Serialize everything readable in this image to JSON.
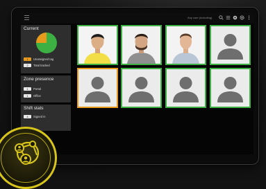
{
  "topbar": {
    "filter_label": "Any user (including)",
    "icons": [
      "search-icon",
      "list-icon",
      "location-icon",
      "settings-icon",
      "more-icon"
    ]
  },
  "current": {
    "title": "Current",
    "unassigned_count": "1",
    "unassigned_label": "Unassigned tag",
    "total_count": "2",
    "total_label": "Total tracked",
    "pie": {
      "assigned_fraction": 0.75,
      "unassigned_fraction": 0.25
    }
  },
  "zone_presence": {
    "title": "Zone presence",
    "portal_count": "1",
    "portal_label": "Portal",
    "office_count": "1",
    "office_label": "Office"
  },
  "shift_stats": {
    "title": "Shift stats",
    "signed_in_count": "4",
    "signed_in_label": "Signed in"
  },
  "colors": {
    "tracked_border": "#3cb043",
    "alert_border": "#e89a1c",
    "pie_green": "#3cb043",
    "pie_orange": "#e89a1c",
    "badge_gold": "#d8c51c"
  },
  "badge": {
    "icon": "network-users-icon"
  }
}
